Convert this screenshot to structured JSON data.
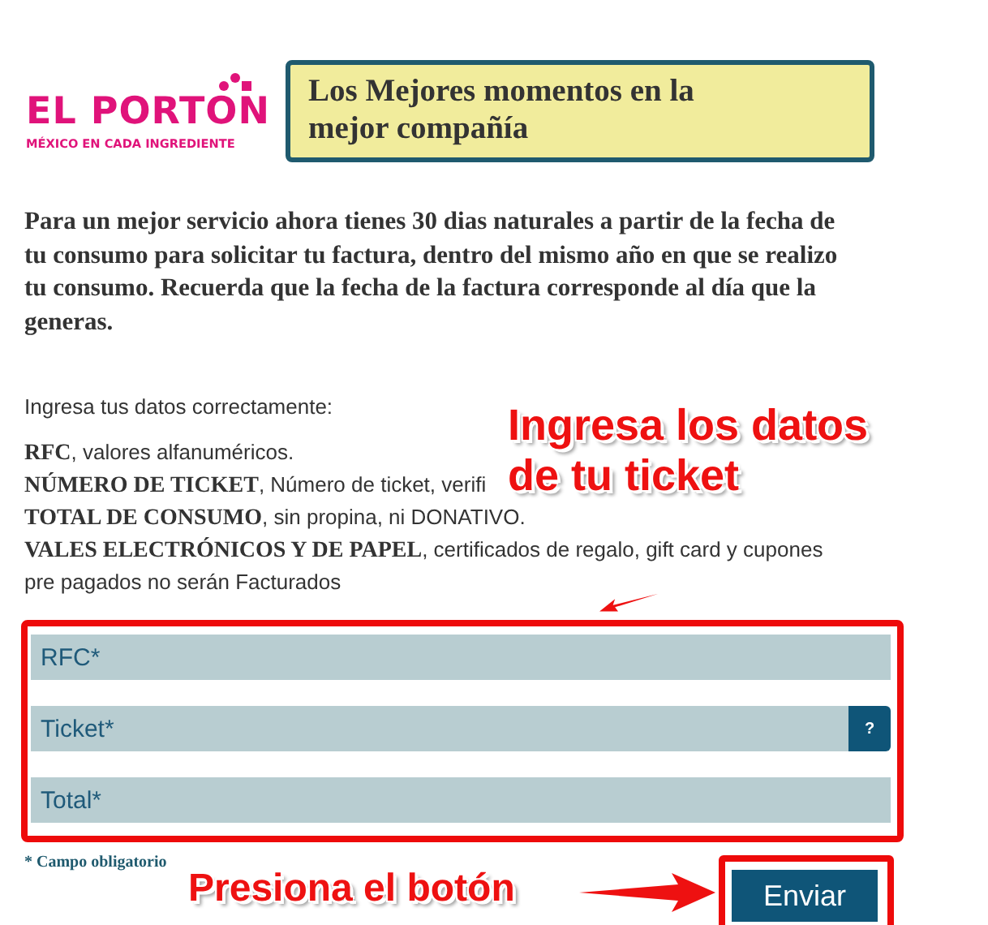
{
  "logo": {
    "name": "EL PORTON",
    "tagline": "MÉXICO EN CADA INGREDIENTE"
  },
  "headline": "Los Mejores momentos en la mejor compañía",
  "intro": "Para un mejor servicio ahora tienes 30 dias naturales a partir de la fecha de tu consumo para solicitar tu factura, dentro del mismo año en que se realizo tu consumo. Recuerda que la fecha de la factura corresponde al día que la generas.",
  "instructions_title": "Ingresa tus datos correctamente:",
  "instructions": [
    "**RFC**, valores alfanuméricos.",
    "**NÚMERO DE TICKET**, Número de ticket, verifi",
    "**TOTAL DE CONSUMO**, sin propina, ni DONATIVO.",
    "**VALES ELECTRÓNICOS Y DE PAPEL**, certificados de regalo, gift card y cupones pre pagados no serán Facturados"
  ],
  "fields": [
    {
      "placeholder": "RFC*"
    },
    {
      "placeholder": "Ticket*",
      "help_button": "?"
    },
    {
      "placeholder": "Total*"
    }
  ],
  "required_note": "* Campo obligatorio",
  "submit_button": "Enviar",
  "annotations": [
    {
      "kind": "fields",
      "text": "Ingresa los datos de tu ticket"
    },
    {
      "kind": "button",
      "text": "Presiona el botón"
    }
  ]
}
